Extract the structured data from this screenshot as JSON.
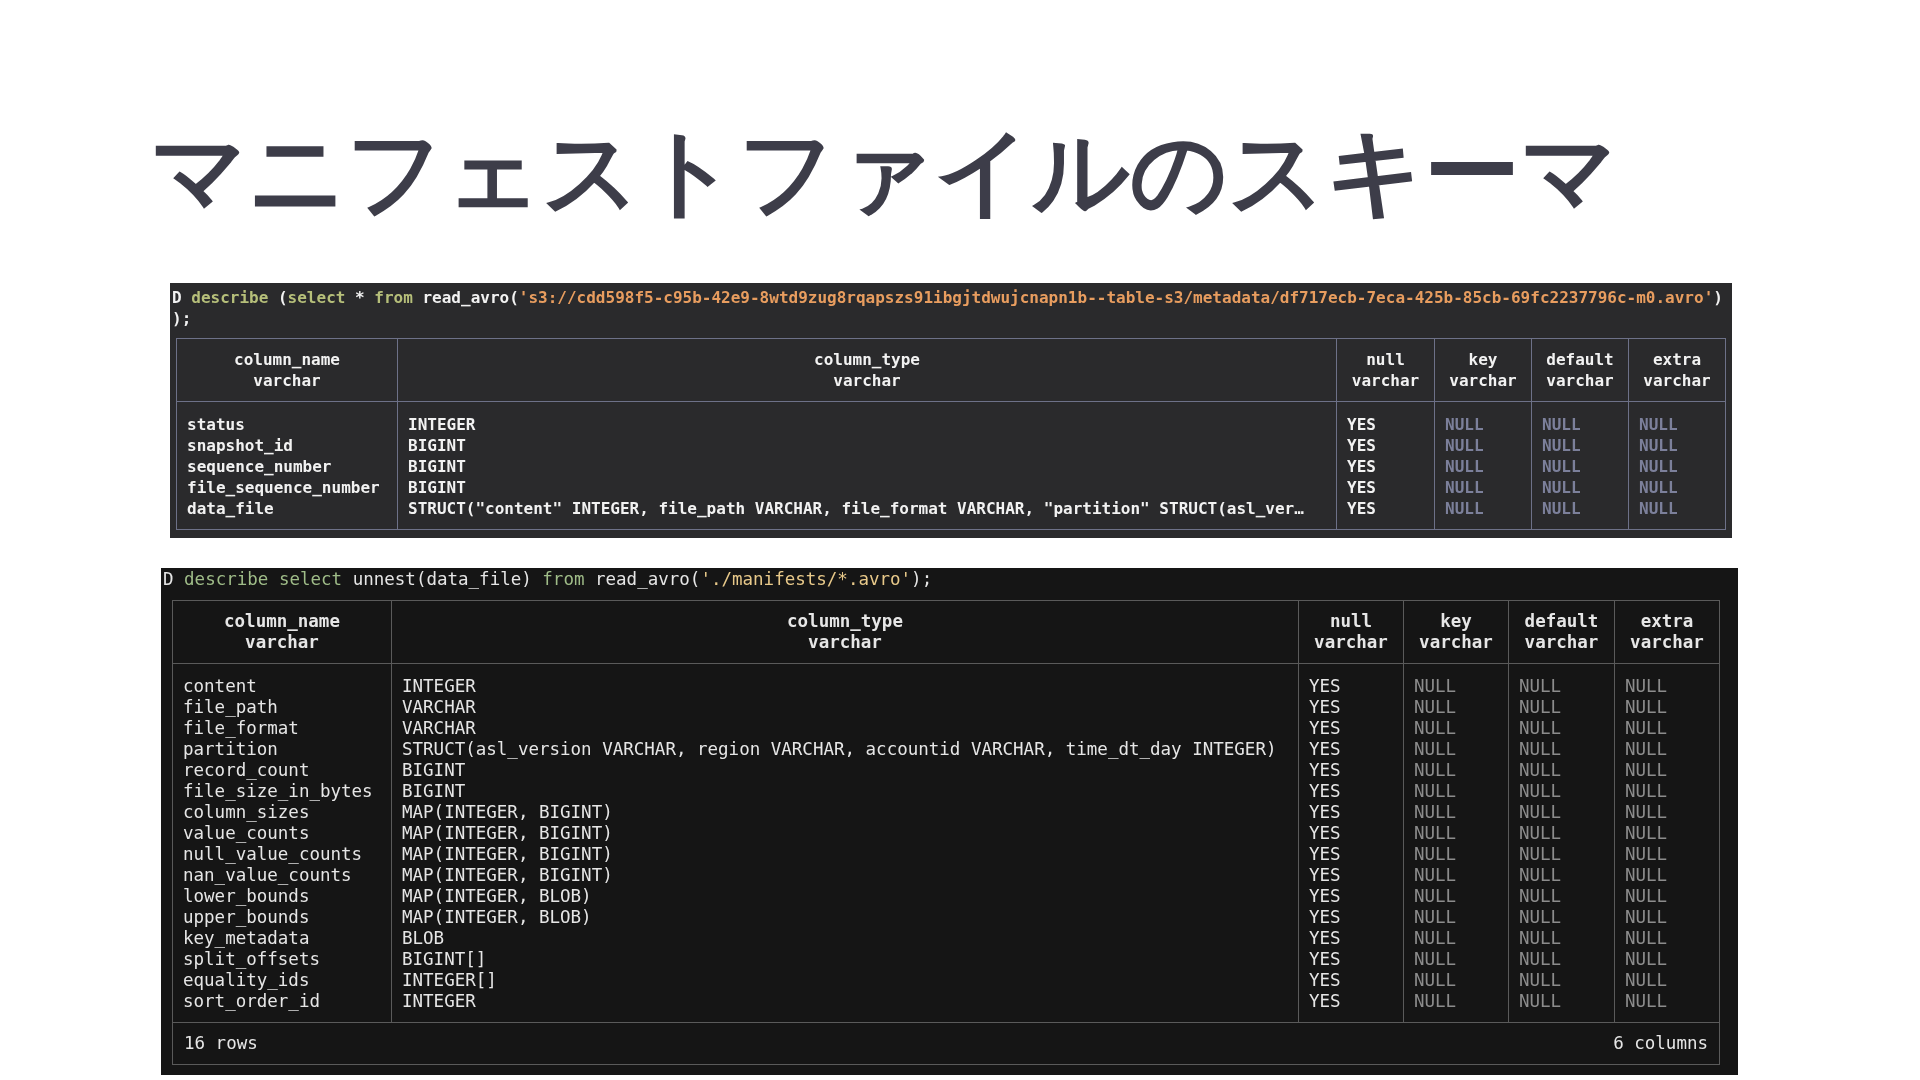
{
  "slide_title": "マニフェストファイルのスキーマ",
  "terminals": [
    {
      "kind": "gray",
      "lines": [
        [
          {
            "kind": "plain",
            "text": "D "
          },
          {
            "kind": "keyword",
            "text": "describe"
          },
          {
            "kind": "plain",
            "text": " ("
          },
          {
            "kind": "keyword",
            "text": "select"
          },
          {
            "kind": "plain",
            "text": " * "
          },
          {
            "kind": "keyword",
            "text": "from"
          },
          {
            "kind": "plain",
            "text": " read_avro("
          },
          {
            "kind": "string",
            "text": "'s3://cdd598f5-c95b-42e9-8wtd9zug8rqapszs91ibgjtdwujcnapn1b--table-s3/metadata/df717ecb-7eca-425b-85cb-69fc2237796c-m0.avro'"
          },
          {
            "kind": "plain",
            "text": ")"
          }
        ],
        [
          {
            "kind": "plain",
            "text": ");"
          }
        ]
      ],
      "columns": [
        {
          "name": "column_name",
          "type": "varchar",
          "muted": false
        },
        {
          "name": "column_type",
          "type": "varchar",
          "muted": false
        },
        {
          "name": "null",
          "type": "varchar",
          "muted": false
        },
        {
          "name": "key",
          "type": "varchar",
          "muted": true
        },
        {
          "name": "default",
          "type": "varchar",
          "muted": true
        },
        {
          "name": "extra",
          "type": "varchar",
          "muted": true
        }
      ],
      "rows": [
        [
          "status",
          "INTEGER",
          "YES",
          "NULL",
          "NULL",
          "NULL"
        ],
        [
          "snapshot_id",
          "BIGINT",
          "YES",
          "NULL",
          "NULL",
          "NULL"
        ],
        [
          "sequence_number",
          "BIGINT",
          "YES",
          "NULL",
          "NULL",
          "NULL"
        ],
        [
          "file_sequence_number",
          "BIGINT",
          "YES",
          "NULL",
          "NULL",
          "NULL"
        ],
        [
          "data_file",
          "STRUCT(\"content\" INTEGER, file_path VARCHAR, file_format VARCHAR, \"partition\" STRUCT(asl_ver…",
          "YES",
          "NULL",
          "NULL",
          "NULL"
        ]
      ]
    },
    {
      "kind": "black",
      "lines": [
        [
          {
            "kind": "plain",
            "text": "D "
          },
          {
            "kind": "keyword",
            "text": "describe select"
          },
          {
            "kind": "plain",
            "text": " unnest(data_file) "
          },
          {
            "kind": "keyword",
            "text": "from"
          },
          {
            "kind": "plain",
            "text": " read_avro("
          },
          {
            "kind": "string",
            "text": "'./manifests/*.avro'"
          },
          {
            "kind": "plain",
            "text": ");"
          }
        ]
      ],
      "columns": [
        {
          "name": "column_name",
          "type": "varchar",
          "muted": false
        },
        {
          "name": "column_type",
          "type": "varchar",
          "muted": false
        },
        {
          "name": "null",
          "type": "varchar",
          "muted": false
        },
        {
          "name": "key",
          "type": "varchar",
          "muted": true
        },
        {
          "name": "default",
          "type": "varchar",
          "muted": true
        },
        {
          "name": "extra",
          "type": "varchar",
          "muted": true
        }
      ],
      "rows": [
        [
          "content",
          "INTEGER",
          "YES",
          "NULL",
          "NULL",
          "NULL"
        ],
        [
          "file_path",
          "VARCHAR",
          "YES",
          "NULL",
          "NULL",
          "NULL"
        ],
        [
          "file_format",
          "VARCHAR",
          "YES",
          "NULL",
          "NULL",
          "NULL"
        ],
        [
          "partition",
          "STRUCT(asl_version VARCHAR, region VARCHAR, accountid VARCHAR, time_dt_day INTEGER)",
          "YES",
          "NULL",
          "NULL",
          "NULL"
        ],
        [
          "record_count",
          "BIGINT",
          "YES",
          "NULL",
          "NULL",
          "NULL"
        ],
        [
          "file_size_in_bytes",
          "BIGINT",
          "YES",
          "NULL",
          "NULL",
          "NULL"
        ],
        [
          "column_sizes",
          "MAP(INTEGER, BIGINT)",
          "YES",
          "NULL",
          "NULL",
          "NULL"
        ],
        [
          "value_counts",
          "MAP(INTEGER, BIGINT)",
          "YES",
          "NULL",
          "NULL",
          "NULL"
        ],
        [
          "null_value_counts",
          "MAP(INTEGER, BIGINT)",
          "YES",
          "NULL",
          "NULL",
          "NULL"
        ],
        [
          "nan_value_counts",
          "MAP(INTEGER, BIGINT)",
          "YES",
          "NULL",
          "NULL",
          "NULL"
        ],
        [
          "lower_bounds",
          "MAP(INTEGER, BLOB)",
          "YES",
          "NULL",
          "NULL",
          "NULL"
        ],
        [
          "upper_bounds",
          "MAP(INTEGER, BLOB)",
          "YES",
          "NULL",
          "NULL",
          "NULL"
        ],
        [
          "key_metadata",
          "BLOB",
          "YES",
          "NULL",
          "NULL",
          "NULL"
        ],
        [
          "split_offsets",
          "BIGINT[]",
          "YES",
          "NULL",
          "NULL",
          "NULL"
        ],
        [
          "equality_ids",
          "INTEGER[]",
          "YES",
          "NULL",
          "NULL",
          "NULL"
        ],
        [
          "sort_order_id",
          "INTEGER",
          "YES",
          "NULL",
          "NULL",
          "NULL"
        ]
      ],
      "footer": {
        "row_count": "16 rows",
        "column_count": "6 columns"
      }
    }
  ]
}
